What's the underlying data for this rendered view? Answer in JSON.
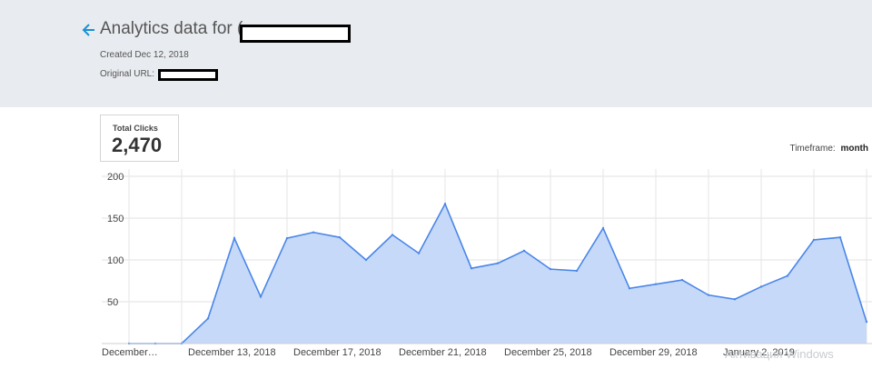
{
  "header": {
    "title": "Analytics data for (",
    "created": "Created Dec 12, 2018",
    "original_url_label": "Original URL:"
  },
  "stats": {
    "total_clicks_label": "Total Clicks",
    "total_clicks_value": "2,470"
  },
  "timeframe": {
    "label": "Timeframe:",
    "value": "month"
  },
  "watermark": "Активация Windows",
  "colors": {
    "line": "#4a86e8",
    "fill": "#c6d9f8",
    "header_bg": "#e8ebef",
    "accent": "#1a91d6"
  },
  "chart_data": {
    "type": "area",
    "y_ticks": [
      "200",
      "150",
      "100",
      "50"
    ],
    "ylim": [
      0,
      200
    ],
    "x_tick_labels": [
      "December…",
      "December 13, 2018",
      "December 17, 2018",
      "December 21, 2018",
      "December 25, 2018",
      "December 29, 2018",
      "January 2, 2019"
    ],
    "x": [
      "Dec 10",
      "Dec 11",
      "Dec 12",
      "Dec 13",
      "Dec 14",
      "Dec 15",
      "Dec 16",
      "Dec 17",
      "Dec 18",
      "Dec 19",
      "Dec 20",
      "Dec 21",
      "Dec 22",
      "Dec 23",
      "Dec 24",
      "Dec 25",
      "Dec 26",
      "Dec 27",
      "Dec 28",
      "Dec 29",
      "Dec 30",
      "Dec 31",
      "Jan 1",
      "Jan 2",
      "Jan 3",
      "Jan 4",
      "Jan 5",
      "Jan 6"
    ],
    "values": [
      0,
      0,
      0,
      30,
      126,
      56,
      126,
      133,
      127,
      100,
      130,
      108,
      167,
      90,
      96,
      111,
      89,
      87,
      138,
      66,
      71,
      76,
      58,
      53,
      68,
      81,
      124,
      127,
      26
    ],
    "grid": true,
    "legend": "none"
  }
}
